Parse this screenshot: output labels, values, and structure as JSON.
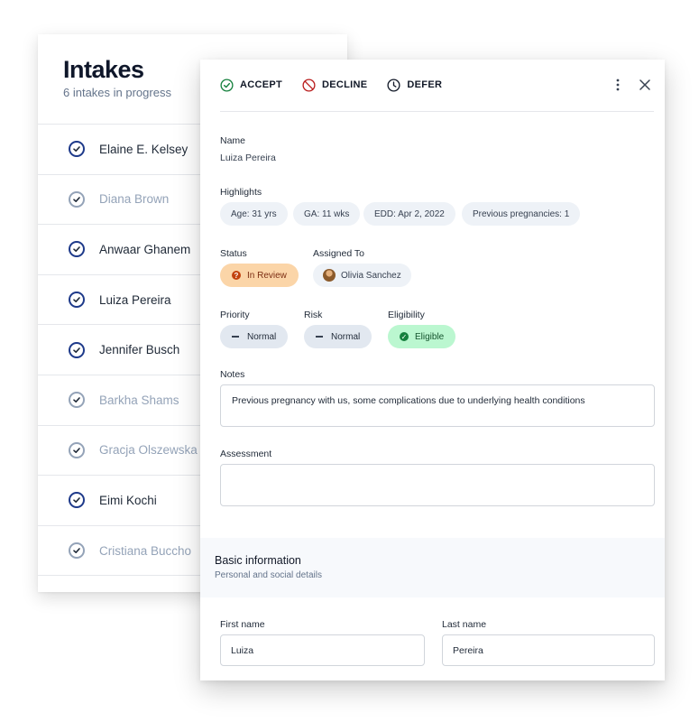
{
  "intakes": {
    "title": "Intakes",
    "subtitle": "6 intakes in progress",
    "items": [
      {
        "name": "Elaine E. Kelsey",
        "active": true
      },
      {
        "name": "Diana Brown",
        "active": false
      },
      {
        "name": "Anwaar Ghanem",
        "active": true
      },
      {
        "name": "Luiza Pereira",
        "active": true
      },
      {
        "name": "Jennifer Busch",
        "active": true
      },
      {
        "name": "Barkha Shams",
        "active": false
      },
      {
        "name": "Gracja Olszewska",
        "active": false
      },
      {
        "name": "Eimi Kochi",
        "active": true
      },
      {
        "name": "Cristiana Buccho",
        "active": false
      }
    ]
  },
  "toolbar": {
    "accept": "ACCEPT",
    "decline": "DECLINE",
    "defer": "DEFER"
  },
  "detail": {
    "name_label": "Name",
    "name_value": "Luiza Pereira",
    "highlights_label": "Highlights",
    "highlights": [
      "Age: 31 yrs",
      "GA: 11 wks",
      "EDD: Apr 2, 2022",
      "Previous pregnancies: 1"
    ],
    "status_label": "Status",
    "status_value": "In Review",
    "assigned_label": "Assigned To",
    "assigned_value": "Olivia Sanchez",
    "priority_label": "Priority",
    "priority_value": "Normal",
    "risk_label": "Risk",
    "risk_value": "Normal",
    "eligibility_label": "Eligibility",
    "eligibility_value": "Eligible",
    "notes_label": "Notes",
    "notes_value": "Previous pregnancy with us, some complications due to underlying health conditions",
    "assessment_label": "Assessment",
    "assessment_value": ""
  },
  "basic_info": {
    "title": "Basic information",
    "subtitle": "Personal and social details",
    "first_name_label": "First name",
    "first_name_value": "Luiza",
    "last_name_label": "Last name",
    "last_name_value": "Pereira"
  },
  "colors": {
    "accent": "#1e3a8a",
    "status_review_bg": "#fbd5a8",
    "eligible_bg": "#bbf7d0",
    "eligible_icon": "#15803d"
  },
  "icons": {
    "accept": "check-circle-icon",
    "decline": "prohibited-icon",
    "defer": "clock-icon",
    "more": "more-vertical-icon",
    "close": "close-icon"
  }
}
